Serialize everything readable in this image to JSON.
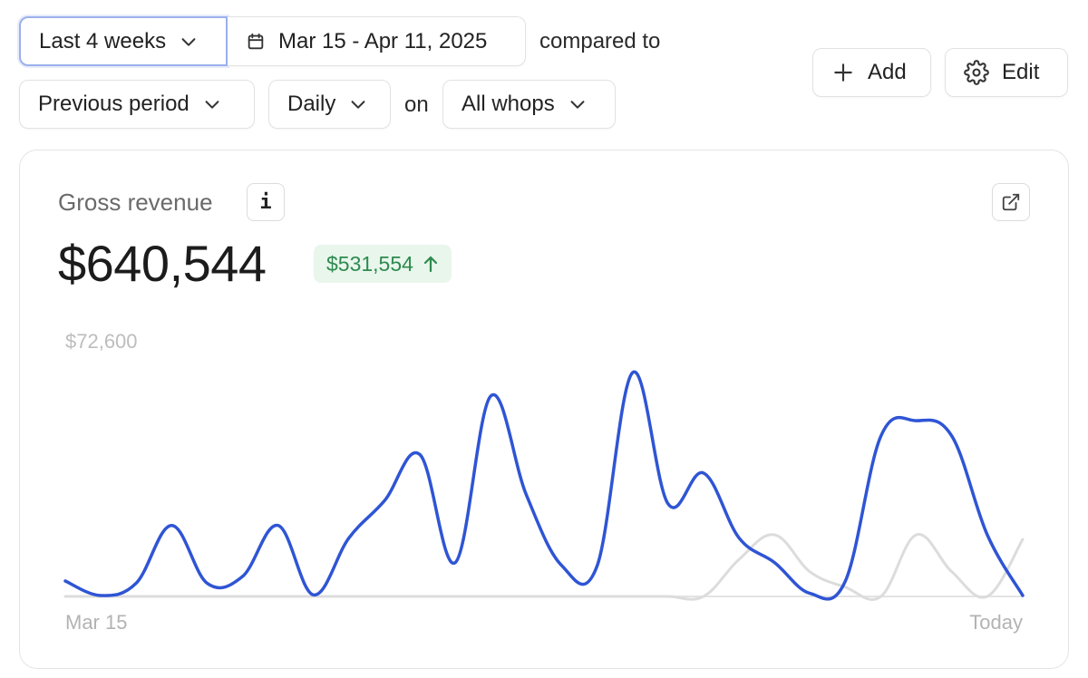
{
  "filters": {
    "range_label": "Last 4 weeks",
    "date_range": "Mar 15 - Apr 11, 2025",
    "compared_to_text": "compared to",
    "comparison_label": "Previous period",
    "interval_label": "Daily",
    "on_text": "on",
    "scope_label": "All whops"
  },
  "toolbar": {
    "add_label": "Add",
    "edit_label": "Edit"
  },
  "metric": {
    "title": "Gross revenue",
    "info_glyph": "i",
    "value": "$640,544",
    "delta": "$531,554",
    "delta_direction": "up",
    "delta_color": "#2f8a4f"
  },
  "icons": {
    "range_chevron": "chevron-down-icon",
    "date": "calendar-icon",
    "add": "plus-icon",
    "edit": "gear-icon",
    "info": "info-icon",
    "open": "external-link-icon"
  },
  "chart_data": {
    "type": "line",
    "x_start_label": "Mar 15",
    "x_end_label": "Today",
    "y_max_label": "$72,600",
    "ylim": [
      0,
      72600
    ],
    "grid": false,
    "series": [
      {
        "color": "#2f55d4",
        "values": [
          5000,
          300,
          4300,
          23000,
          4300,
          6500,
          23000,
          500,
          19000,
          31000,
          46000,
          11000,
          65000,
          33000,
          10000,
          10000,
          72600,
          30000,
          40000,
          19000,
          11000,
          1000,
          5000,
          52000,
          57000,
          52000,
          20000,
          300
        ]
      },
      {
        "color": "#dcdcdc",
        "values": [
          0,
          0,
          0,
          0,
          0,
          0,
          0,
          0,
          0,
          0,
          0,
          0,
          0,
          0,
          0,
          0,
          0,
          0,
          0,
          12000,
          20000,
          8000,
          3000,
          0,
          20000,
          8000,
          0,
          18500
        ]
      }
    ]
  }
}
